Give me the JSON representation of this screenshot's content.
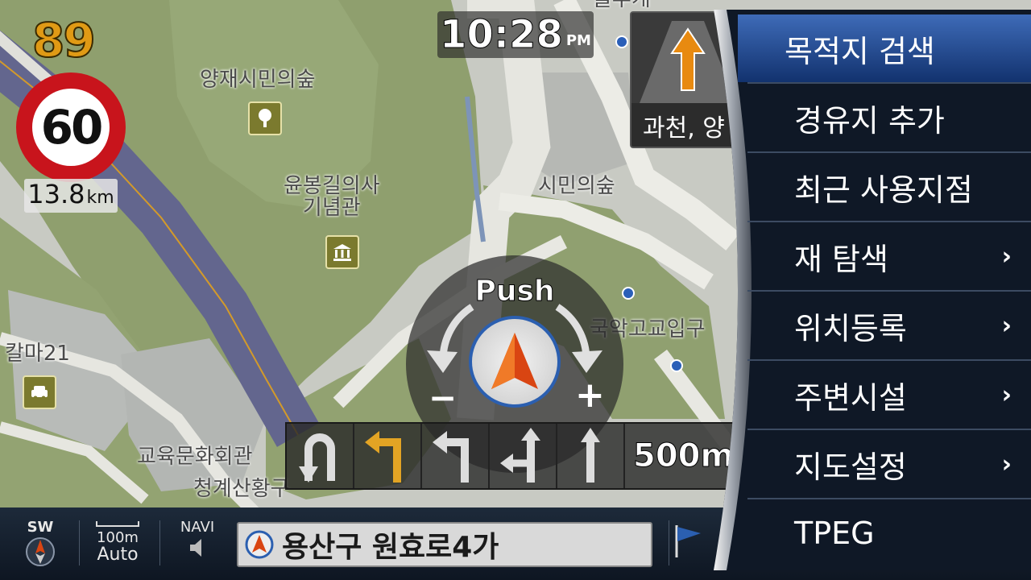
{
  "hud": {
    "speed_count": "89",
    "speed_limit": "60",
    "limit_distance_value": "13.8",
    "limit_distance_unit": "km",
    "clock_time": "10:28",
    "clock_ampm": "PM",
    "lane_view_road": "과천, 양"
  },
  "map_labels": {
    "park": "양재시민의숲",
    "memorial_line1": "윤봉길의사",
    "memorial_line2": "기념관",
    "forest": "시민의숲",
    "school_gate": "국악고교입구",
    "kalma": "칼마21",
    "culture_hall": "교육문화회관",
    "cheonggye": "청계산황구",
    "top_road": "블루캐"
  },
  "compass_control": {
    "push_label": "Push",
    "zoom_out": "−",
    "zoom_in": "+"
  },
  "lane_guide": {
    "lanes": [
      "u-turn",
      "left",
      "left",
      "left-straight",
      "straight"
    ],
    "highlighted_lane": 1,
    "distance": "500m"
  },
  "bottom_bar": {
    "compass_heading": "SW",
    "scale_value": "100m",
    "scale_mode": "Auto",
    "audio_label": "NAVI",
    "current_road": "용산구 원효로4가"
  },
  "menu": {
    "items": [
      {
        "label": "목적지 검색",
        "has_submenu": false,
        "selected": true
      },
      {
        "label": "경유지 추가",
        "has_submenu": false,
        "selected": false
      },
      {
        "label": "최근 사용지점",
        "has_submenu": false,
        "selected": false
      },
      {
        "label": "재 탐색",
        "has_submenu": true,
        "selected": false
      },
      {
        "label": "위치등록",
        "has_submenu": true,
        "selected": false
      },
      {
        "label": "주변시설",
        "has_submenu": true,
        "selected": false
      },
      {
        "label": "지도설정",
        "has_submenu": true,
        "selected": false
      },
      {
        "label": "TPEG",
        "has_submenu": false,
        "selected": false
      }
    ],
    "chevron": "›"
  },
  "colors": {
    "accent_orange": "#e08a10",
    "speed_sign_red": "#c8141c",
    "menu_selected_blue": "#2a56a0",
    "menu_bg": "#0f1826"
  }
}
